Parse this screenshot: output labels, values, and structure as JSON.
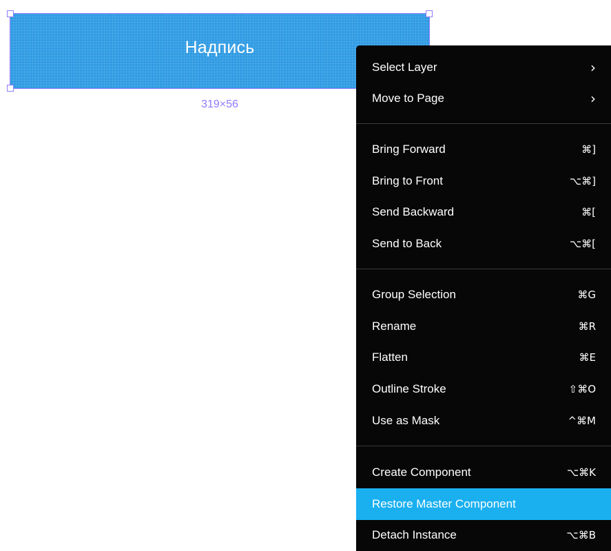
{
  "canvas": {
    "frame_text": "Надпись",
    "dimensions": "319×56",
    "frame_color": "#2f9be3",
    "selection_color": "#8c7bff"
  },
  "context_menu": {
    "highlight_color": "#1ab0f0",
    "items": [
      {
        "label": "Select Layer",
        "shortcut": "›",
        "icon": "chevron-right-icon"
      },
      {
        "label": "Move to Page",
        "shortcut": "›",
        "icon": "chevron-right-icon"
      },
      {
        "label": "Bring Forward",
        "shortcut": "⌘]"
      },
      {
        "label": "Bring to Front",
        "shortcut": "⌥⌘]"
      },
      {
        "label": "Send Backward",
        "shortcut": "⌘["
      },
      {
        "label": "Send to Back",
        "shortcut": "⌥⌘["
      },
      {
        "label": "Group Selection",
        "shortcut": "⌘G"
      },
      {
        "label": "Rename",
        "shortcut": "⌘R"
      },
      {
        "label": "Flatten",
        "shortcut": "⌘E"
      },
      {
        "label": "Outline Stroke",
        "shortcut": "⇧⌘O"
      },
      {
        "label": "Use as Mask",
        "shortcut": "^⌘M"
      },
      {
        "label": "Create Component",
        "shortcut": "⌥⌘K"
      },
      {
        "label": "Restore Master Component",
        "shortcut": "",
        "highlighted": true
      },
      {
        "label": "Detach Instance",
        "shortcut": "⌥⌘B"
      }
    ]
  }
}
